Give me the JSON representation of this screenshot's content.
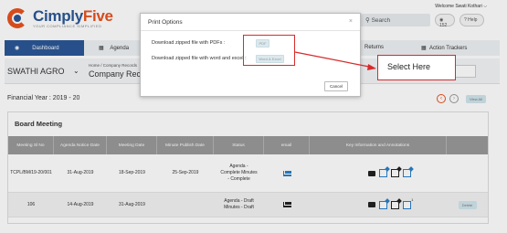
{
  "header": {
    "logo_primary": "Cimply",
    "logo_accent": "Five",
    "logo_tagline": "YOUR COMPLIANCE SIMPLIFIED",
    "welcome_text": "Welcome Swati Kothari",
    "search_placeholder": "Search",
    "notification_count": "152",
    "help_label": "Help"
  },
  "nav": {
    "items": [
      {
        "label": "Dashboard"
      },
      {
        "label": "Agenda"
      },
      {
        "label": "Returns"
      },
      {
        "label": "Action Trackers"
      }
    ]
  },
  "entity_bar": {
    "entity_name": "SWATHI AGRO",
    "breadcrumb": "Home / Company Records",
    "page_title": "Company Records"
  },
  "financial_year": "Financial Year : 2019 - 20",
  "pager": {
    "button_label": "View All"
  },
  "board_meeting": {
    "title": "Board Meeting",
    "columns": [
      "Meeting Sl No",
      "Agenda Notice Date",
      "Meeting Date",
      "Minute Publish Date",
      "Status",
      "email",
      "Key Information and Annotations",
      ""
    ],
    "rows": [
      {
        "sl_no": "TCPL/BM/19-20/001",
        "agenda_notice_date": "31-Aug-2019",
        "meeting_date": "18-Sep-2019",
        "minute_publish_date": "25-Sep-2019",
        "status": "Agenda - Complete Minutes - Complete",
        "action": ""
      },
      {
        "sl_no": "106",
        "agenda_notice_date": "14-Aug-2019",
        "meeting_date": "31-Aug-2019",
        "minute_publish_date": "",
        "status": "Agenda - Draft Minutes - Draft",
        "action": "Delete"
      }
    ]
  },
  "print_modal": {
    "title": "Print Options",
    "option_pdf_label": "Download zipped file with PDFs :",
    "option_pdf_button": "PDF",
    "option_word_label": "Download zipped file with word and excel :",
    "option_word_button": "Word & Excel",
    "cancel_label": "Cancel"
  },
  "annotation": {
    "callout_text": "Select Here",
    "color": "#d62b2b"
  },
  "colors": {
    "brand_blue": "#2b5797",
    "brand_orange": "#e8531f",
    "table_header": "#999999",
    "icon_blue": "#2b7fc8"
  }
}
